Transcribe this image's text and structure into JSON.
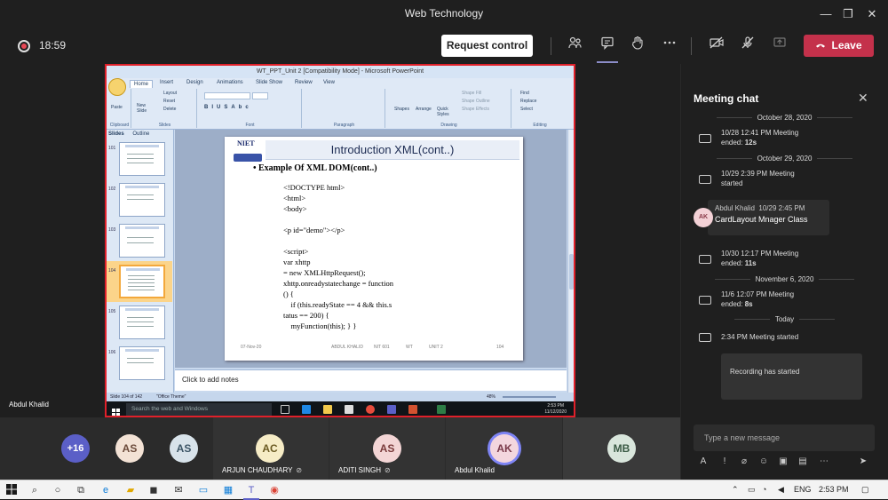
{
  "window": {
    "title": "Web Technology",
    "minimize_glyph": "—",
    "restore_glyph": "❐",
    "close_glyph": "✕"
  },
  "toolbar": {
    "timer": "18:59",
    "request_control_label": "Request control",
    "leave_label": "Leave",
    "icons": [
      "people-icon",
      "chat-icon",
      "raise-hand-icon",
      "more-icon",
      "camera-off-icon",
      "mic-off-icon",
      "share-icon"
    ]
  },
  "presenter_name": "Abdul Khalid",
  "powerpoint": {
    "window_title": "WT_PPT_Unit 2 [Compatibility Mode] - Microsoft PowerPoint",
    "tabs": [
      "Home",
      "Insert",
      "Design",
      "Animations",
      "Slide Show",
      "Review",
      "View"
    ],
    "ribbon_groups": [
      "Clipboard",
      "Slides",
      "Font",
      "Paragraph",
      "Drawing",
      "Editing"
    ],
    "ribbon_buttons": {
      "paste": "Paste",
      "new_slide": "New Slide",
      "layout": "Layout",
      "reset": "Reset",
      "delete": "Delete",
      "shapes": "Shapes",
      "arrange": "Arrange",
      "quick_styles": "Quick Styles",
      "shape_fill": "Shape Fill",
      "shape_outline": "Shape Outline",
      "shape_effects": "Shape Effects",
      "find": "Find",
      "replace": "Replace",
      "select": "Select"
    },
    "pane_tabs": {
      "slides": "Slides",
      "outline": "Outline"
    },
    "thumb_numbers": [
      "101",
      "102",
      "103",
      "104",
      "105",
      "106"
    ],
    "slide": {
      "logo_text": "NIET",
      "title": "Introduction XML(cont..)",
      "bullet": "• Example Of XML DOM(cont..)",
      "code_lines": [
        "<!DOCTYPE html>",
        "<html>",
        "<body>",
        "",
        "<p id=\"demo\"></p>",
        "",
        "<script>",
        "var xhttp",
        "= new XMLHttpRequest();",
        "xhttp.onreadystatechange = function",
        "() {",
        "    if (this.readyState == 4 && this.s",
        "tatus == 200) {",
        "    myFunction(this); } }"
      ],
      "footer": {
        "date": "07-Nov-20",
        "author": "ABDUL KHALID",
        "unit": "NIT 601",
        "subject": "WT",
        "unit2": "UNIT 2",
        "page": "104"
      }
    },
    "notes_placeholder": "Click to add notes",
    "status": {
      "slide_info": "Slide 104 of 142",
      "theme": "\"Office Theme\"",
      "zoom": "48%"
    },
    "inner_taskbar": {
      "search_placeholder": "Search the web and Windows",
      "time": "2:53 PM",
      "date": "11/12/2020"
    }
  },
  "participants": {
    "overflow": "+16",
    "tiles": [
      {
        "initials": "AS",
        "name": "",
        "bg": "#f3e2d5",
        "fg": "#6b4a3a"
      },
      {
        "initials": "AS",
        "name": "",
        "bg": "#d8e3ea",
        "fg": "#3c5566"
      },
      {
        "initials": "AC",
        "name": "ARJUN CHAUDHARY",
        "bg": "#f6ecc6",
        "fg": "#6b5a22"
      },
      {
        "initials": "AS",
        "name": "ADITI SINGH",
        "bg": "#f3d5d5",
        "fg": "#7a3a3a"
      },
      {
        "initials": "AK",
        "name": "Abdul Khalid",
        "bg": "#f3d6de",
        "fg": "#7a3a4a"
      },
      {
        "initials": "MB",
        "name": "",
        "bg": "#d9e6dc",
        "fg": "#3a5a44"
      }
    ]
  },
  "chat": {
    "title": "Meeting chat",
    "entries": [
      {
        "type": "date",
        "text": "October 28, 2020"
      },
      {
        "type": "event",
        "line1": "10/28 12:41 PM   Meeting",
        "line2_prefix": "ended: ",
        "line2_bold": "12s"
      },
      {
        "type": "date",
        "text": "October 29, 2020"
      },
      {
        "type": "event",
        "line1": "10/29 2:39 PM   Meeting",
        "line2_prefix": "started",
        "line2_bold": ""
      },
      {
        "type": "message",
        "initials": "AK",
        "author": "Abdul Khalid",
        "time": "10/29 2:45 PM",
        "text": "CardLayout Mnager Class"
      },
      {
        "type": "event",
        "line1": "10/30 12:17 PM   Meeting",
        "line2_prefix": "ended: ",
        "line2_bold": "11s"
      },
      {
        "type": "date",
        "text": "November 6, 2020"
      },
      {
        "type": "event",
        "line1": "11/6 12:07 PM   Meeting",
        "line2_prefix": "ended: ",
        "line2_bold": "8s"
      },
      {
        "type": "date",
        "text": "Today"
      },
      {
        "type": "event",
        "line1": "2:34 PM   Meeting started",
        "line2_prefix": "",
        "line2_bold": ""
      },
      {
        "type": "card",
        "text": "Recording has started"
      }
    ],
    "input_placeholder": "Type a new message",
    "tools": [
      "format-icon",
      "important-icon",
      "attach-icon",
      "emoji-icon",
      "gif-icon",
      "sticker-icon",
      "more-icon",
      "send-icon"
    ]
  },
  "os_taskbar": {
    "language": "ENG",
    "time": "2:53 PM"
  }
}
